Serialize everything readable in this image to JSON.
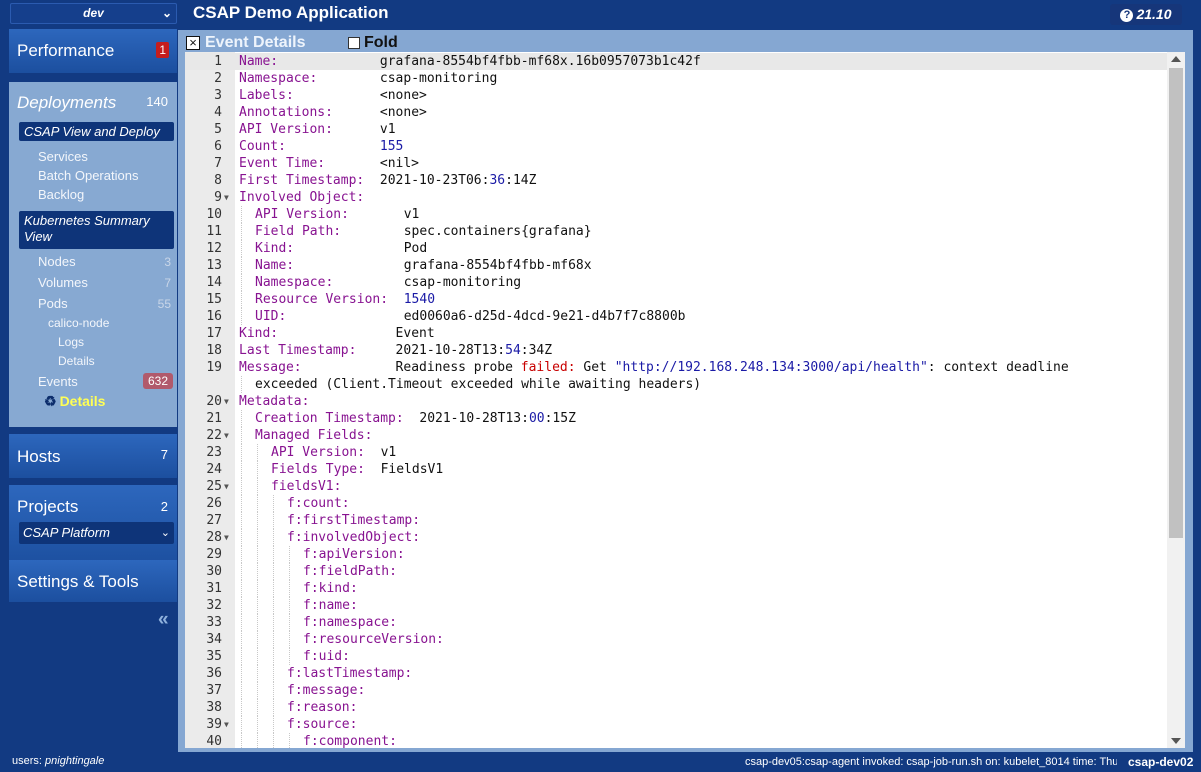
{
  "env_select": "dev",
  "app_title": "CSAP Demo Application",
  "version": "21.10",
  "nav": {
    "performance": {
      "label": "Performance",
      "badge": "1"
    },
    "deployments": {
      "label": "Deployments",
      "count": "140",
      "csap_view": "CSAP View and Deploy",
      "services": "Services",
      "batch": "Batch Operations",
      "backlog": "Backlog",
      "k8s_summary": "Kubernetes Summary View",
      "nodes": "Nodes",
      "nodes_count": "3",
      "volumes": "Volumes",
      "volumes_count": "7",
      "pods": "Pods",
      "pods_count": "55",
      "calico": "calico-node",
      "logs": "Logs",
      "pod_details": "Details",
      "events": "Events",
      "events_count": "632",
      "events_details": "Details"
    },
    "hosts": {
      "label": "Hosts",
      "count": "7"
    },
    "projects": {
      "label": "Projects",
      "count": "2",
      "selected": "CSAP Platform"
    },
    "settings": {
      "label": "Settings & Tools"
    }
  },
  "panel": {
    "title": "Event Details",
    "fold_label": "Fold"
  },
  "footer": {
    "users_label": "users:",
    "user": "pnightingale"
  },
  "status": {
    "text": "csap-dev05:csap-agent invoked: csap-job-run.sh on: kubelet_8014 time: Thu",
    "host": "csap-dev02"
  },
  "colors": {
    "key": "#881391",
    "number": "#1a1aa6",
    "error": "#c80000",
    "badge_red": "#c51d1d",
    "highlight": "#ffff55"
  },
  "editor": {
    "lines": [
      {
        "n": "1",
        "i": 0,
        "segs": [
          [
            "k",
            "Name:"
          ],
          [
            "v",
            "             grafana-8554bf4fbb-mf68x.16b0957073b1c42f"
          ]
        ]
      },
      {
        "n": "2",
        "i": 0,
        "segs": [
          [
            "k",
            "Namespace:"
          ],
          [
            "v",
            "        csap-monitoring"
          ]
        ]
      },
      {
        "n": "3",
        "i": 0,
        "segs": [
          [
            "k",
            "Labels:"
          ],
          [
            "v",
            "           <none>"
          ]
        ]
      },
      {
        "n": "4",
        "i": 0,
        "segs": [
          [
            "k",
            "Annotations:"
          ],
          [
            "v",
            "      <none>"
          ]
        ]
      },
      {
        "n": "5",
        "i": 0,
        "segs": [
          [
            "k",
            "API Version:"
          ],
          [
            "v",
            "      v1"
          ]
        ]
      },
      {
        "n": "6",
        "i": 0,
        "segs": [
          [
            "k",
            "Count:"
          ],
          [
            "n",
            "            155"
          ]
        ]
      },
      {
        "n": "7",
        "i": 0,
        "segs": [
          [
            "k",
            "Event Time:"
          ],
          [
            "v",
            "       <nil>"
          ]
        ]
      },
      {
        "n": "8",
        "i": 0,
        "segs": [
          [
            "k",
            "First Timestamp:"
          ],
          [
            "v",
            "  2021-10-23T06:"
          ],
          [
            "n",
            "36"
          ],
          [
            "v",
            ":14Z"
          ]
        ]
      },
      {
        "n": "9",
        "i": 0,
        "f": true,
        "segs": [
          [
            "k",
            "Involved Object:"
          ]
        ]
      },
      {
        "n": "10",
        "i": 1,
        "segs": [
          [
            "k",
            "API Version:"
          ],
          [
            "v",
            "       v1"
          ]
        ]
      },
      {
        "n": "11",
        "i": 1,
        "segs": [
          [
            "k",
            "Field Path:"
          ],
          [
            "v",
            "        spec.containers{grafana}"
          ]
        ]
      },
      {
        "n": "12",
        "i": 1,
        "segs": [
          [
            "k",
            "Kind:"
          ],
          [
            "v",
            "              Pod"
          ]
        ]
      },
      {
        "n": "13",
        "i": 1,
        "segs": [
          [
            "k",
            "Name:"
          ],
          [
            "v",
            "              grafana-8554bf4fbb-mf68x"
          ]
        ]
      },
      {
        "n": "14",
        "i": 1,
        "segs": [
          [
            "k",
            "Namespace:"
          ],
          [
            "v",
            "         csap-monitoring"
          ]
        ]
      },
      {
        "n": "15",
        "i": 1,
        "segs": [
          [
            "k",
            "Resource Version:"
          ],
          [
            "n",
            "  1540"
          ]
        ]
      },
      {
        "n": "16",
        "i": 1,
        "segs": [
          [
            "k",
            "UID:"
          ],
          [
            "v",
            "               ed0060a6-d25d-4dcd-9e21-d4b7f7c8800b"
          ]
        ]
      },
      {
        "n": "17",
        "i": 0,
        "segs": [
          [
            "k",
            "Kind:"
          ],
          [
            "v",
            "               Event"
          ]
        ]
      },
      {
        "n": "18",
        "i": 0,
        "segs": [
          [
            "k",
            "Last Timestamp:"
          ],
          [
            "v",
            "     2021-10-28T13:"
          ],
          [
            "n",
            "54"
          ],
          [
            "v",
            ":34Z"
          ]
        ]
      },
      {
        "n": "19",
        "i": 0,
        "segs": [
          [
            "k",
            "Message:"
          ],
          [
            "v",
            "            Readiness probe "
          ],
          [
            "r",
            "failed:"
          ],
          [
            "v",
            " Get "
          ],
          [
            "s",
            "\"http://192.168.248.134:3000/api/health\""
          ],
          [
            "v",
            ": context deadline"
          ]
        ]
      },
      {
        "n": "",
        "i": 1,
        "segs": [
          [
            "v",
            "exceeded (Client.Timeout exceeded while awaiting headers)"
          ]
        ]
      },
      {
        "n": "20",
        "i": 0,
        "f": true,
        "segs": [
          [
            "k",
            "Metadata:"
          ]
        ]
      },
      {
        "n": "21",
        "i": 1,
        "segs": [
          [
            "k",
            "Creation Timestamp:"
          ],
          [
            "v",
            "  2021-10-28T13:"
          ],
          [
            "n",
            "00"
          ],
          [
            "v",
            ":15Z"
          ]
        ]
      },
      {
        "n": "22",
        "i": 1,
        "f": true,
        "segs": [
          [
            "k",
            "Managed Fields:"
          ]
        ]
      },
      {
        "n": "23",
        "i": 2,
        "segs": [
          [
            "k",
            "API Version:"
          ],
          [
            "v",
            "  v1"
          ]
        ]
      },
      {
        "n": "24",
        "i": 2,
        "segs": [
          [
            "k",
            "Fields Type:"
          ],
          [
            "v",
            "  FieldsV1"
          ]
        ]
      },
      {
        "n": "25",
        "i": 2,
        "f": true,
        "segs": [
          [
            "k",
            "fieldsV1:"
          ]
        ]
      },
      {
        "n": "26",
        "i": 3,
        "segs": [
          [
            "k",
            "f:count:"
          ]
        ]
      },
      {
        "n": "27",
        "i": 3,
        "segs": [
          [
            "k",
            "f:firstTimestamp:"
          ]
        ]
      },
      {
        "n": "28",
        "i": 3,
        "f": true,
        "segs": [
          [
            "k",
            "f:involvedObject:"
          ]
        ]
      },
      {
        "n": "29",
        "i": 4,
        "segs": [
          [
            "k",
            "f:apiVersion:"
          ]
        ]
      },
      {
        "n": "30",
        "i": 4,
        "segs": [
          [
            "k",
            "f:fieldPath:"
          ]
        ]
      },
      {
        "n": "31",
        "i": 4,
        "segs": [
          [
            "k",
            "f:kind:"
          ]
        ]
      },
      {
        "n": "32",
        "i": 4,
        "segs": [
          [
            "k",
            "f:name:"
          ]
        ]
      },
      {
        "n": "33",
        "i": 4,
        "segs": [
          [
            "k",
            "f:namespace:"
          ]
        ]
      },
      {
        "n": "34",
        "i": 4,
        "segs": [
          [
            "k",
            "f:resourceVersion:"
          ]
        ]
      },
      {
        "n": "35",
        "i": 4,
        "segs": [
          [
            "k",
            "f:uid:"
          ]
        ]
      },
      {
        "n": "36",
        "i": 3,
        "segs": [
          [
            "k",
            "f:lastTimestamp:"
          ]
        ]
      },
      {
        "n": "37",
        "i": 3,
        "segs": [
          [
            "k",
            "f:message:"
          ]
        ]
      },
      {
        "n": "38",
        "i": 3,
        "segs": [
          [
            "k",
            "f:reason:"
          ]
        ]
      },
      {
        "n": "39",
        "i": 3,
        "f": true,
        "segs": [
          [
            "k",
            "f:source:"
          ]
        ]
      },
      {
        "n": "40",
        "i": 4,
        "segs": [
          [
            "k",
            "f:component:"
          ]
        ]
      }
    ]
  }
}
